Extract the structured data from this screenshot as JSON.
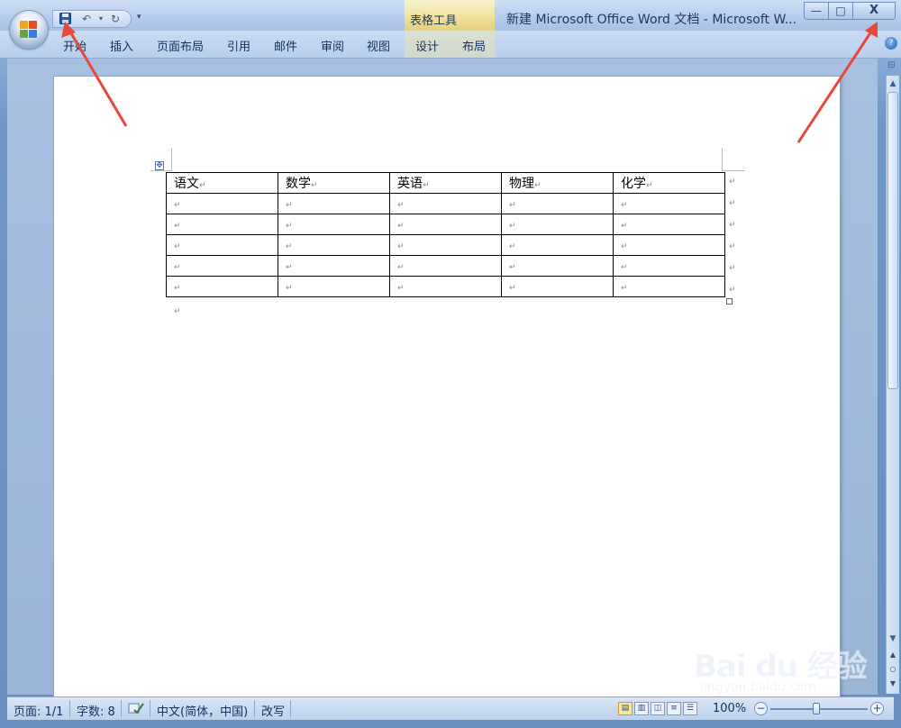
{
  "window": {
    "title": "新建 Microsoft Office Word 文档 - Microsoft W...",
    "context_tab_group": "表格工具",
    "controls": {
      "minimize": "—",
      "maximize": "□",
      "close": "X"
    }
  },
  "quick_access": {
    "save": "save-icon",
    "undo": "undo-icon",
    "redo": "redo-icon",
    "more": "▾"
  },
  "ribbon": {
    "tabs": [
      "开始",
      "插入",
      "页面布局",
      "引用",
      "邮件",
      "审阅",
      "视图",
      "设计",
      "布局"
    ],
    "help": "?"
  },
  "document": {
    "table": {
      "headers": [
        "语文",
        "数学",
        "英语",
        "物理",
        "化学"
      ],
      "empty_rows": 5,
      "paragraph_mark": "↵"
    }
  },
  "status": {
    "page": "页面: 1/1",
    "word_count": "字数: 8",
    "language": "中文(简体，中国)",
    "mode": "改写",
    "zoom": "100%",
    "zoom_level": 100
  },
  "watermark": {
    "logo": "Bai du 经验",
    "url": "jingyan.baidu.com"
  },
  "colors": {
    "frame": "#8fb0da",
    "ribbon": "#c9dbf2",
    "arrow": "#e8483b",
    "context_tab": "#f9e38a"
  }
}
